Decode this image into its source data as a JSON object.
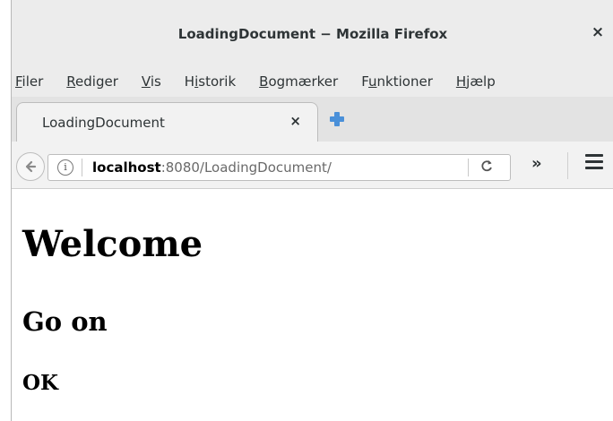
{
  "window": {
    "title": "LoadingDocument − Mozilla Firefox"
  },
  "menubar": {
    "items": [
      {
        "label": "Filer"
      },
      {
        "label": "Rediger"
      },
      {
        "label": "Vis"
      },
      {
        "label": "Historik"
      },
      {
        "label": "Bogmærker"
      },
      {
        "label": "Funktioner"
      },
      {
        "label": "Hjælp"
      }
    ]
  },
  "tabs": [
    {
      "label": "LoadingDocument",
      "close": "×"
    }
  ],
  "navbar": {
    "url_host": "localhost",
    "url_rest": ":8080/LoadingDocument/",
    "overflow": "»"
  },
  "page": {
    "h1": "Welcome",
    "h2": "Go on",
    "h3": "OK"
  },
  "icons": {
    "new_tab": "plus-icon",
    "back": "back-arrow-icon",
    "info": "info-icon",
    "reload": "reload-icon",
    "menu": "hamburger-menu-icon"
  },
  "colors": {
    "new_tab_plus": "#4a90d9"
  }
}
